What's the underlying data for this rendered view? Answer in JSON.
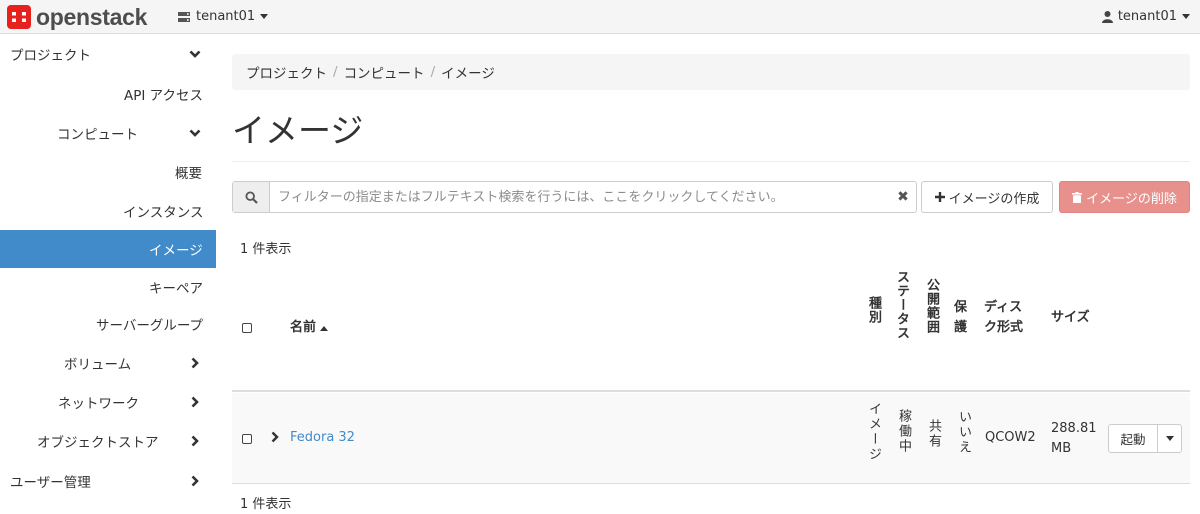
{
  "topbar": {
    "logo_text": "openstack",
    "project": "tenant01",
    "user": "tenant01"
  },
  "sidebar": {
    "items": [
      {
        "label": "プロジェクト"
      },
      {
        "label": "API アクセス"
      },
      {
        "label": "コンピュート"
      },
      {
        "label": "概要"
      },
      {
        "label": "インスタンス"
      },
      {
        "label": "イメージ"
      },
      {
        "label": "キーペア"
      },
      {
        "label": "サーバーグループ"
      },
      {
        "label": "ボリューム"
      },
      {
        "label": "ネットワーク"
      },
      {
        "label": "オブジェクトストア"
      },
      {
        "label": "ユーザー管理"
      }
    ]
  },
  "breadcrumb": [
    "プロジェクト",
    "コンピュート",
    "イメージ"
  ],
  "page_title": "イメージ",
  "toolbar": {
    "search_placeholder": "フィルターの指定またはフルテキスト検索を行うには、ここをクリックしてください。",
    "create_label": "イメージの作成",
    "delete_label": "イメージの削除"
  },
  "table": {
    "count_top": "1 件表示",
    "count_bottom": "1 件表示",
    "headers": {
      "name": "名前",
      "type": "種別",
      "status": "ステータス",
      "visibility": "公開範囲",
      "protected": "保護",
      "disk_format": "ディスク形式",
      "size": "サイズ"
    },
    "rows": [
      {
        "name": "Fedora 32",
        "type": "イメージ",
        "status": "稼働中",
        "visibility": "共有",
        "protected": "いいえ",
        "disk_format": "QCOW2",
        "size": "288.81 MB",
        "action": "起動"
      }
    ]
  }
}
